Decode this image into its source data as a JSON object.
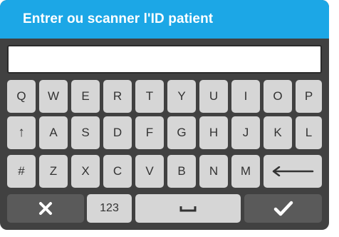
{
  "header": {
    "title": "Entrer ou scanner l'ID patient"
  },
  "input": {
    "value": ""
  },
  "keyboard": {
    "row1": [
      "Q",
      "W",
      "E",
      "R",
      "T",
      "Y",
      "U",
      "I",
      "O",
      "P"
    ],
    "row2": [
      "↑",
      "A",
      "S",
      "D",
      "F",
      "G",
      "H",
      "J",
      "K",
      "L"
    ],
    "row3": [
      "#",
      "Z",
      "X",
      "C",
      "V",
      "B",
      "N",
      "M"
    ],
    "numeric_label": "123"
  },
  "icons": {
    "shift": "shift-up-arrow-icon",
    "backspace": "backspace-arrow-icon",
    "cancel": "close-x-icon",
    "space": "space-bar-icon",
    "confirm": "checkmark-icon"
  },
  "colors": {
    "header_bg": "#1ca7e6",
    "keyboard_bg": "#414141",
    "key_bg": "#d6d6d6",
    "function_key_bg": "#5a5a5a"
  }
}
